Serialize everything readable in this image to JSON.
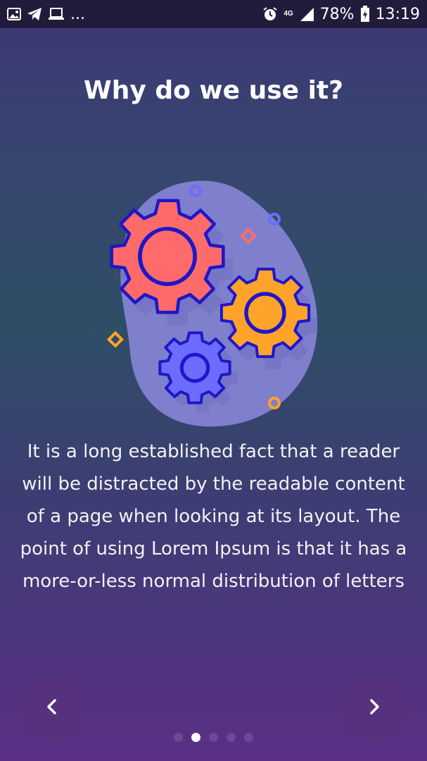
{
  "status_bar": {
    "battery": "78%",
    "time": "13:19",
    "network": "4G",
    "more": "...",
    "icons": [
      "gallery-icon",
      "telegram-icon",
      "laptop-icon",
      "alarm-icon",
      "signal-icon",
      "battery-charging-icon"
    ]
  },
  "page": {
    "title": "Why do we use it?",
    "body": "It is a long established fact that a reader will be distracted by the readable content of a page when looking at its layout. The point of using Lorem Ipsum is that it has a more-or-less normal distribution of letters"
  },
  "navigation": {
    "prev_symbol": "‹",
    "next_symbol": "›",
    "dots_total": 5,
    "active_index": 1
  },
  "colors": {
    "gear_red": "#ff6b6b",
    "gear_orange": "#ffa32b",
    "gear_blue": "#6c6cff",
    "outline": "#1e17c8",
    "blob": "#8c8ade"
  }
}
